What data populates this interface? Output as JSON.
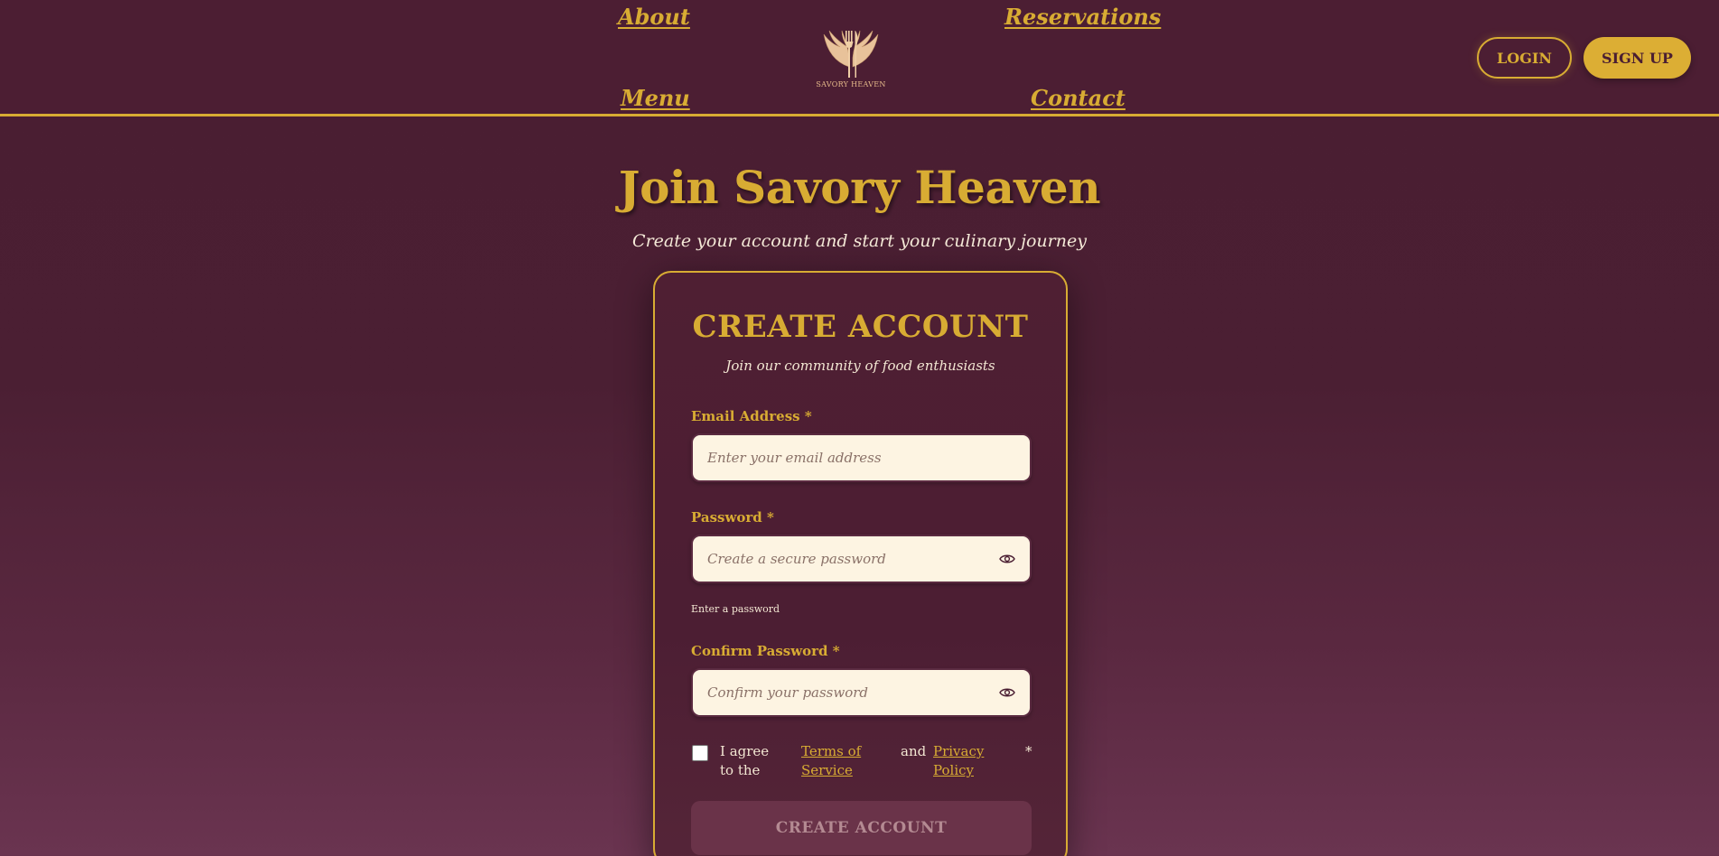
{
  "nav": {
    "about": "About",
    "reservations": "Reservations",
    "menu": "Menu",
    "contact": "Contact"
  },
  "logo": {
    "text": "SAVORY HEAVEN"
  },
  "auth": {
    "login": "LOGIN",
    "signup": "SIGN UP"
  },
  "hero": {
    "title": "Join Savory Heaven",
    "subtitle": "Create your account and start your culinary journey"
  },
  "form": {
    "title": "CREATE ACCOUNT",
    "subtitle": "Join our community of food enthusiasts",
    "email": {
      "label": "Email Address *",
      "placeholder": "Enter your email address",
      "value": ""
    },
    "password": {
      "label": "Password *",
      "placeholder": "Create a secure password",
      "value": "",
      "hint": "Enter a password"
    },
    "confirm": {
      "label": "Confirm Password *",
      "placeholder": "Confirm your password",
      "value": ""
    },
    "agree": {
      "prefix": "I agree to the",
      "terms": "Terms of Service",
      "and": "and",
      "privacy": "Privacy Policy",
      "required": "*",
      "checked": false
    },
    "submit": "CREATE ACCOUNT"
  },
  "colors": {
    "background": "#4a1e32",
    "accent": "#d8ac33",
    "input_bg": "#fdf4e2",
    "button_disabled": "#6a3349"
  },
  "icons": {
    "password_toggle": "eye-icon",
    "confirm_toggle": "eye-icon",
    "logo": "winged-fork-logo"
  }
}
